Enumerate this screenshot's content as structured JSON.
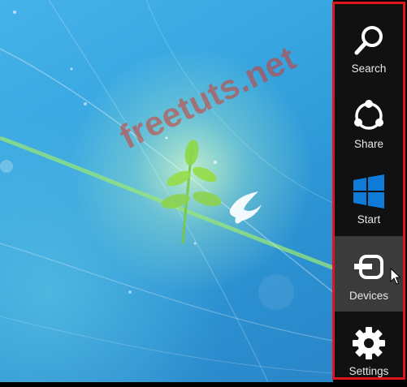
{
  "watermark": "freetuts.net",
  "charms": [
    {
      "id": "search",
      "label": "Search",
      "icon": "search-icon"
    },
    {
      "id": "share",
      "label": "Share",
      "icon": "share-icon"
    },
    {
      "id": "start",
      "label": "Start",
      "icon": "windows-logo-icon"
    },
    {
      "id": "devices",
      "label": "Devices",
      "icon": "devices-icon",
      "active": true
    },
    {
      "id": "settings",
      "label": "Settings",
      "icon": "gear-icon"
    }
  ],
  "colors": {
    "charm_bar": "#111111",
    "highlight_border": "#e0141c",
    "active_charm": "#3b3b3b",
    "windows_blue": "#0f7bd8"
  }
}
